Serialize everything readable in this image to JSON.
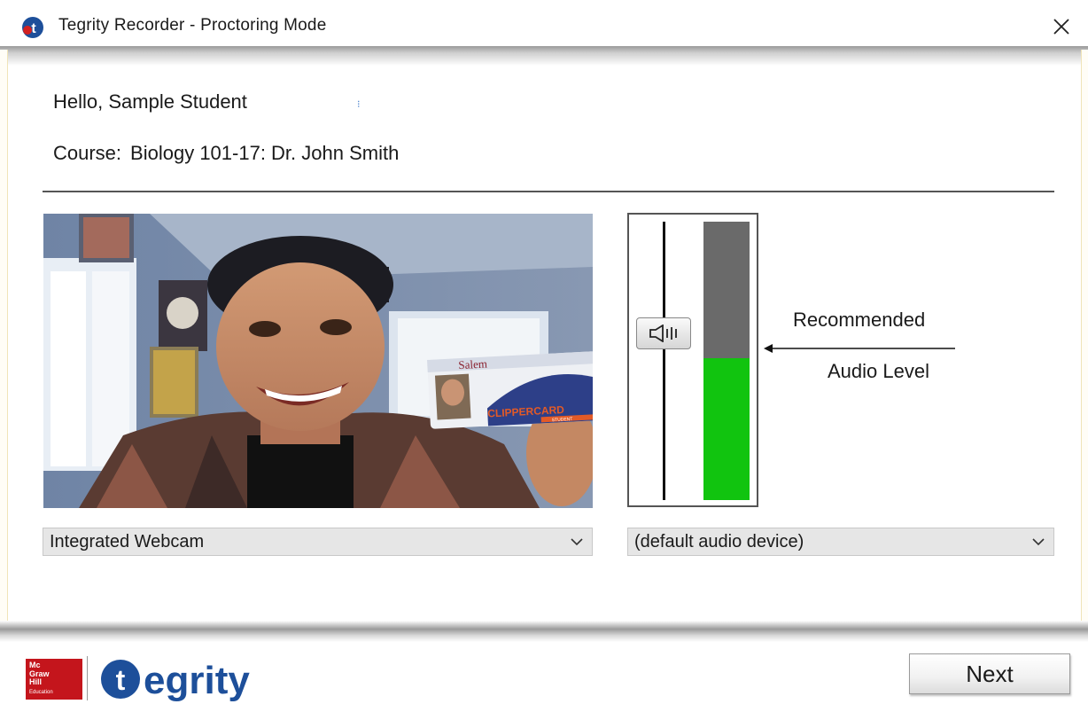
{
  "window": {
    "title": "Tegrity Recorder - Proctoring Mode",
    "app_icon": "tegrity-t-icon",
    "close_icon": "close-icon"
  },
  "header": {
    "greeting": "Hello, Sample Student",
    "course_label": "Course:",
    "course_value": "Biology 101-17: Dr.  John Smith"
  },
  "video": {
    "feed": "webcam-preview",
    "device_selected": "Integrated Webcam",
    "card_text": "CLIPPERCARD",
    "card_sub": "STUDENT",
    "card_school": "Salem"
  },
  "audio": {
    "device_selected": "(default audio device)",
    "level_fraction": 0.51,
    "recommended_label_1": "Recommended",
    "recommended_label_2": "Audio Level",
    "handle_icon": "speaker-icon",
    "meter_fill_color": "#11c40f",
    "meter_empty_color": "#6a6a6a"
  },
  "footer": {
    "publisher_logo_text": "Mc Graw Hill Education",
    "brand_text": "tegrity",
    "brand_color": "#1d4f9a",
    "next_label": "Next"
  }
}
